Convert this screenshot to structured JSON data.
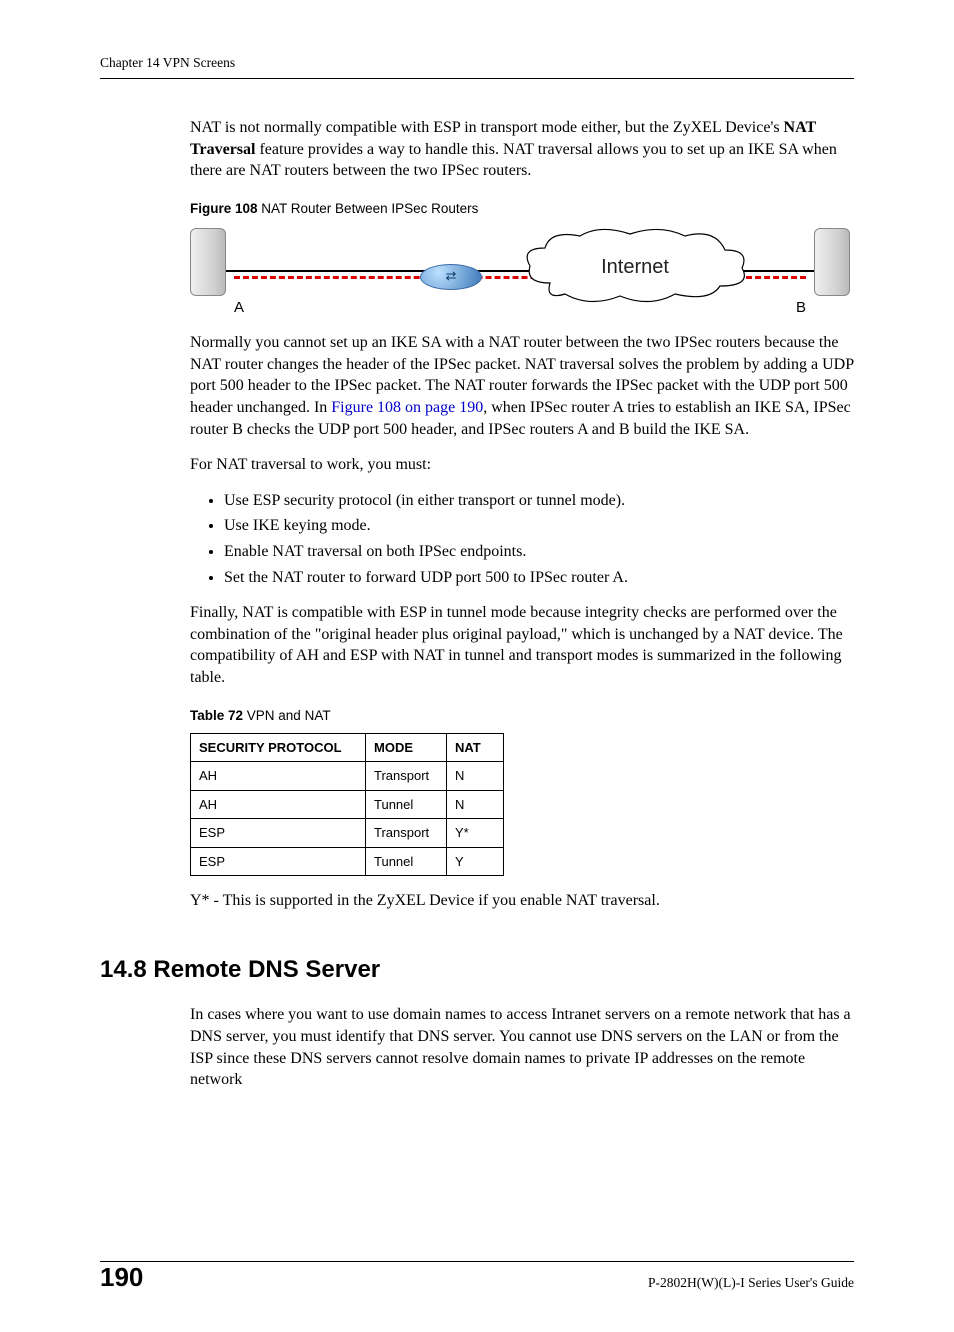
{
  "header": "Chapter 14 VPN Screens",
  "para1_a": "NAT is not normally compatible with ESP in transport mode either, but the ZyXEL Device's ",
  "para1_bold": "NAT Traversal",
  "para1_b": " feature provides a way to handle this. NAT traversal allows you to set up an IKE SA when there are NAT routers between the two IPSec routers.",
  "fig_caption_bold": "Figure 108",
  "fig_caption_text": "   NAT Router Between IPSec Routers",
  "diagram": {
    "label_a": "A",
    "label_b": "B",
    "cloud": "Internet"
  },
  "para2_a": "Normally you cannot set up an IKE SA with a NAT router between the two IPSec routers because the NAT router changes the header of the IPSec packet. NAT traversal solves the problem by adding a UDP port 500 header to the IPSec packet. The NAT router forwards the IPSec packet with the UDP port 500 header unchanged. In ",
  "para2_link": "Figure 108 on page 190",
  "para2_b": ", when IPSec router A tries to establish an IKE SA, IPSec router B checks the UDP port 500 header, and IPSec routers A and B build the IKE SA.",
  "para3": "For NAT traversal to work, you must:",
  "bullets": [
    "Use ESP security protocol (in either transport or tunnel mode).",
    "Use IKE keying mode.",
    "Enable NAT traversal on both IPSec endpoints.",
    "Set the NAT router to forward UDP port 500 to IPSec router A."
  ],
  "para4": "Finally, NAT is compatible with ESP in tunnel mode because integrity checks are performed over the combination of the \"original header plus original payload,\" which is unchanged by a NAT device. The compatibility of AH and ESP with NAT in tunnel and transport modes is summarized in the following table.",
  "table_caption_bold": "Table 72",
  "table_caption_text": "   VPN and NAT",
  "table": {
    "headers": [
      "SECURITY PROTOCOL",
      "MODE",
      "NAT"
    ],
    "rows": [
      [
        "AH",
        "Transport",
        "N"
      ],
      [
        "AH",
        "Tunnel",
        "N"
      ],
      [
        "ESP",
        "Transport",
        "Y*"
      ],
      [
        "ESP",
        "Tunnel",
        "Y"
      ]
    ]
  },
  "para5": "Y* - This is supported in the ZyXEL Device if you enable NAT traversal.",
  "section_heading": "14.8  Remote DNS Server",
  "para6": "In cases where you want to use domain names to access Intranet servers on a remote network that has a DNS server, you must identify that DNS server. You cannot use DNS servers on the LAN or from the ISP since these DNS servers cannot resolve domain names to private IP addresses on the remote network",
  "footer": {
    "page": "190",
    "guide": "P-2802H(W)(L)-I Series User's Guide"
  }
}
